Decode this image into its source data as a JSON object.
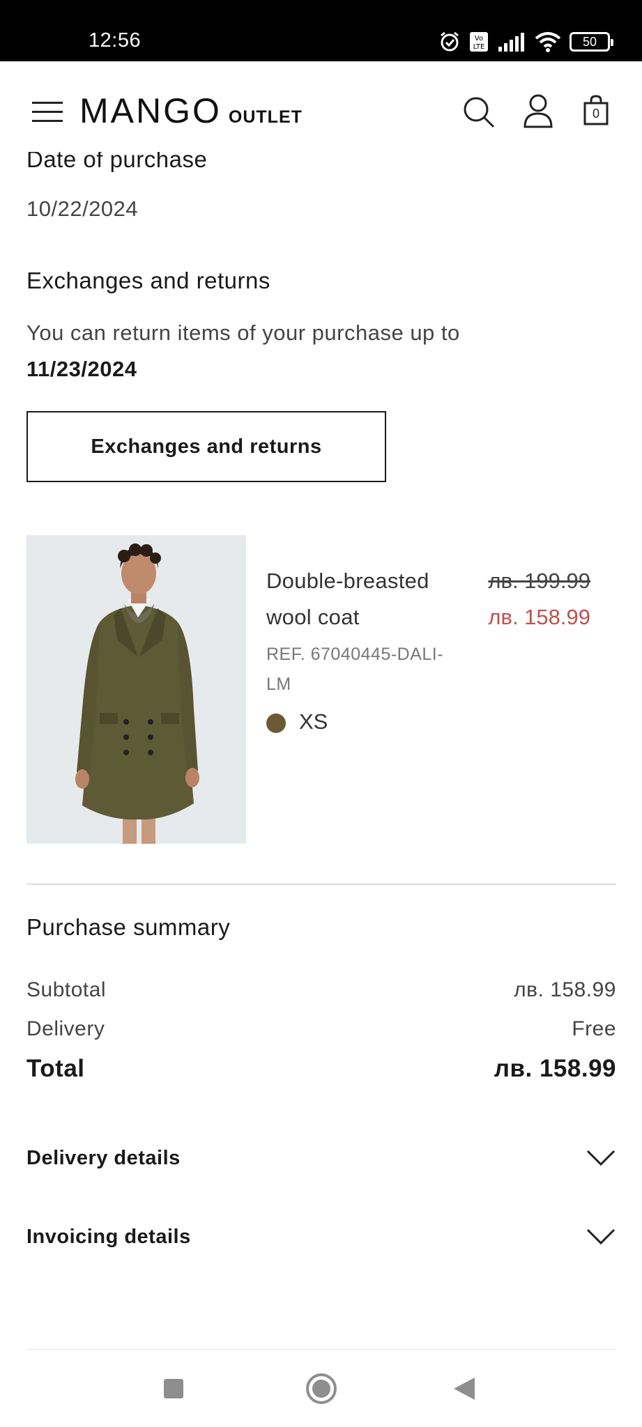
{
  "status_bar": {
    "time": "12:56",
    "battery": "50"
  },
  "header": {
    "logo_main": "MANGO",
    "logo_sub": "OUTLET",
    "cart_count": "0"
  },
  "order": {
    "date_heading": "Date of purchase",
    "date_value": "10/22/2024",
    "returns_heading": "Exchanges and returns",
    "returns_text": "You can return items of your purchase up to",
    "returns_deadline": "11/23/2024",
    "returns_button": "Exchanges and returns"
  },
  "product": {
    "name": "Double-breasted wool coat",
    "price_old": "лв. 199.99",
    "price_new": "лв. 158.99",
    "ref": "REF. 67040445-DALI-LM",
    "color": "#6b5a36",
    "size": "XS"
  },
  "summary": {
    "heading": "Purchase summary",
    "subtotal_label": "Subtotal",
    "subtotal_value": "лв. 158.99",
    "delivery_label": "Delivery",
    "delivery_value": "Free",
    "total_label": "Total",
    "total_value": "лв. 158.99"
  },
  "sections": {
    "delivery_details": "Delivery details",
    "invoicing_details": "Invoicing details"
  },
  "colors": {
    "sale_red": "#c0504d",
    "text_dark": "#1a1a1a"
  }
}
